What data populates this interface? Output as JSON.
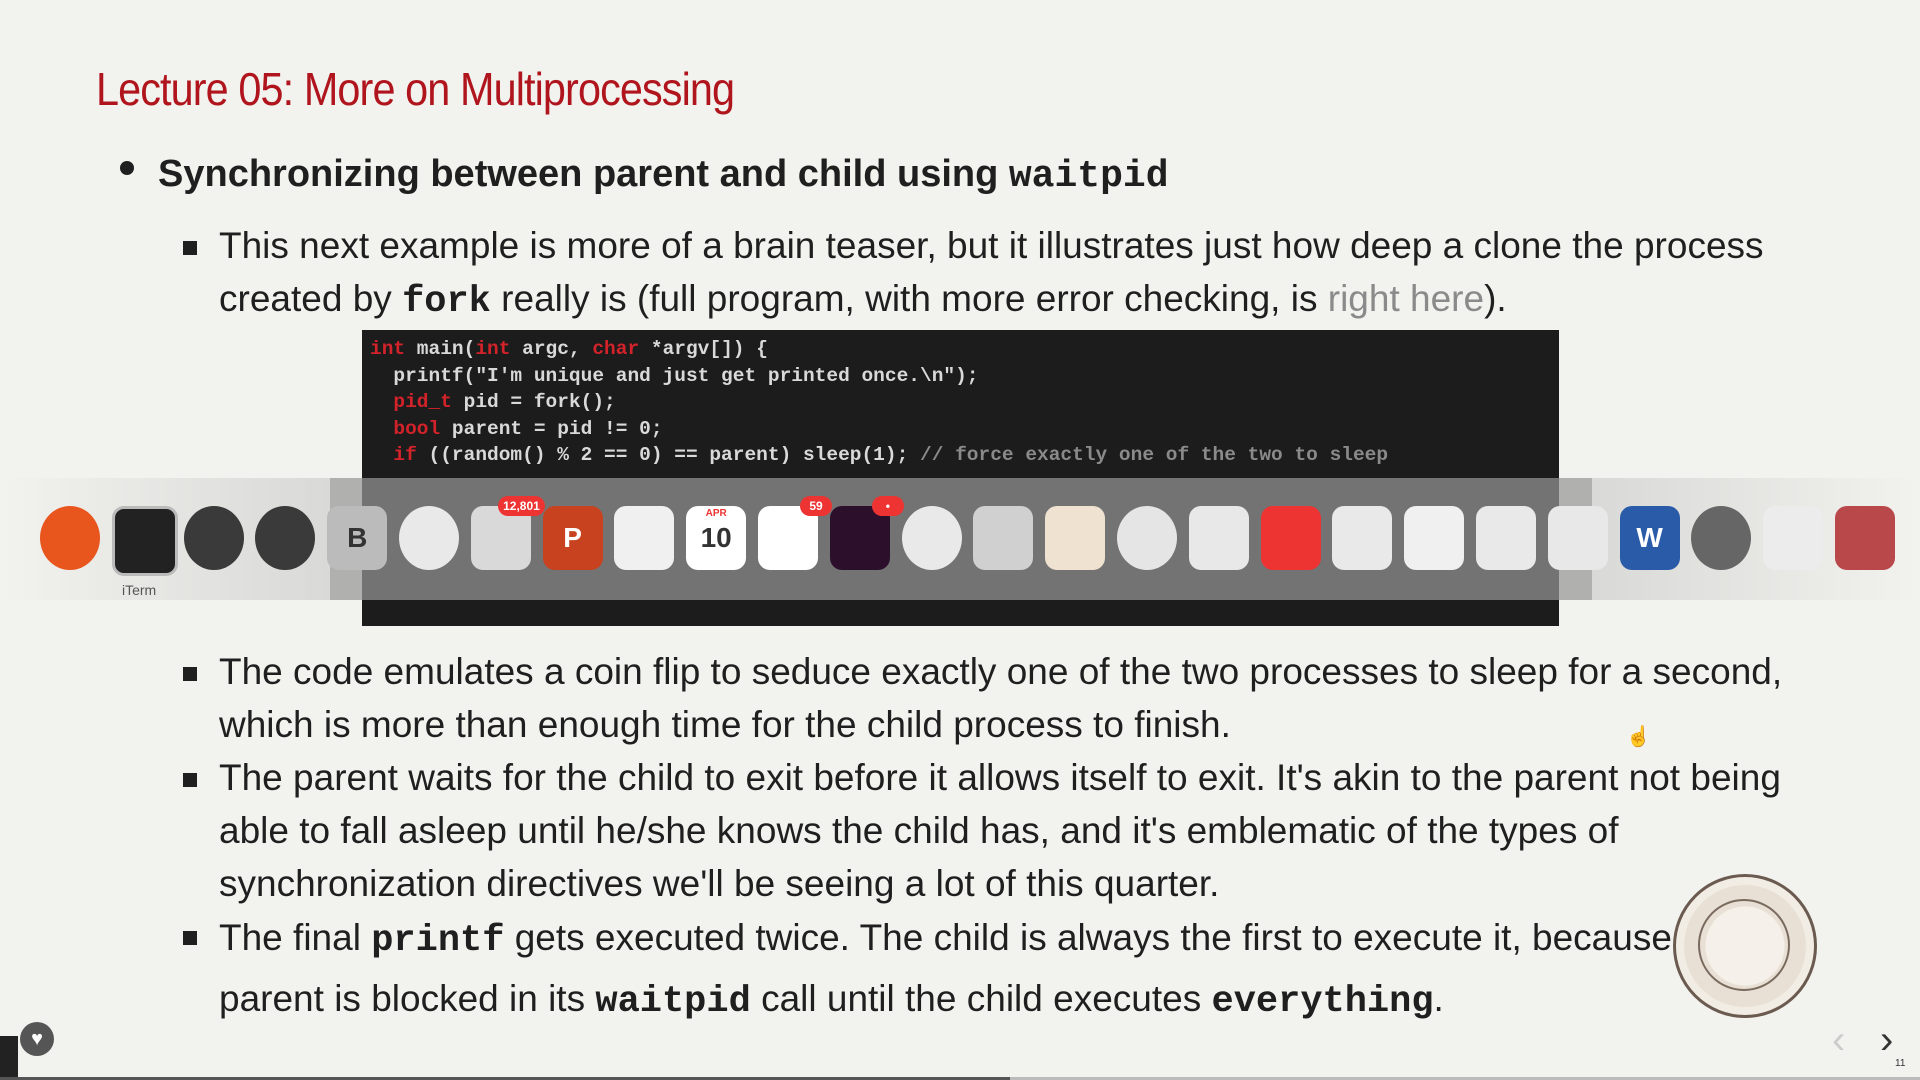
{
  "slide": {
    "title": "Lecture 05: More on Multiprocessing",
    "bullet1": {
      "text": "Synchronizing between parent and child using ",
      "code": "waitpid"
    },
    "sub1": {
      "text_a": "This next example is more of a brain teaser, but it illustrates just how deep a clone the process created by ",
      "code": "fork",
      "text_b": " really is (full program, with more error checking, is ",
      "link": "right here",
      "text_c": ")."
    },
    "sub2": "The code emulates a coin flip to seduce exactly one of the two processes to sleep for a second, which is more than enough time for the child process to finish.",
    "sub3": "The parent waits for the child to exit before it allows itself to exit. It's akin to the parent not being able to fall asleep until he/she knows the child has, and it's emblematic of the types of synchronization directives we'll be seeing a lot of this quarter.",
    "sub4": {
      "text_a": "The final ",
      "code_a": "printf",
      "text_b": " gets executed twice. The child is always the first to execute it, because the parent is blocked in its ",
      "code_b": "waitpid",
      "text_c": " call until the child executes ",
      "code_c": "everything",
      "text_d": "."
    },
    "code_lines": [
      {
        "kw1": "int",
        "a": " main(",
        "kw2": "int",
        "b": " argc, ",
        "kw3": "char",
        "c": " *argv[]) {"
      },
      {
        "a": "  printf(\"I'm unique and just get printed once.\\n\");"
      },
      {
        "kw1": "  pid_t",
        "a": " pid = fork();"
      },
      {
        "kw1": "  bool",
        "a": " parent = pid != 0;"
      },
      {
        "kw1": "  if",
        "a": " ((random() % 2 == 0) == parent) sleep(1); ",
        "cm": "// force exactly one of the two to sleep"
      }
    ],
    "page_number": "11"
  },
  "dock": {
    "items": [
      {
        "name": "firefox-icon",
        "label": ""
      },
      {
        "name": "iterm-icon",
        "label": "iTerm"
      },
      {
        "name": "quill-icon",
        "label": ""
      },
      {
        "name": "quicktime-icon",
        "label": ""
      },
      {
        "name": "bbedit-icon",
        "label": "B"
      },
      {
        "name": "safari-icon",
        "label": ""
      },
      {
        "name": "mail-icon",
        "label": "",
        "badge": "12,801"
      },
      {
        "name": "powerpoint-icon",
        "label": "P"
      },
      {
        "name": "messages-icon",
        "label": ""
      },
      {
        "name": "calendar-icon",
        "label": "10",
        "month": "APR"
      },
      {
        "name": "reminders-icon",
        "label": "",
        "badge": "59"
      },
      {
        "name": "slack-icon",
        "label": "",
        "badge": "•"
      },
      {
        "name": "chrome-icon",
        "label": ""
      },
      {
        "name": "preview-icon",
        "label": ""
      },
      {
        "name": "textedit-icon",
        "label": ""
      },
      {
        "name": "teamviewer-icon",
        "label": ""
      },
      {
        "name": "finder-icon",
        "label": ""
      },
      {
        "name": "airmail-icon",
        "label": ""
      },
      {
        "name": "photo-booth-icon",
        "label": ""
      },
      {
        "name": "keynote-icon",
        "label": ""
      },
      {
        "name": "photos-icon",
        "label": ""
      },
      {
        "name": "screen-draw-icon",
        "label": ""
      },
      {
        "name": "word-icon",
        "label": "W"
      },
      {
        "name": "system-preferences-icon",
        "label": ""
      },
      {
        "name": "folder-icon",
        "label": ""
      },
      {
        "name": "trash-icon",
        "label": ""
      }
    ]
  },
  "colors": {
    "title": "#b0151e",
    "keyword": "#d2222a",
    "link": "#8a8a8a",
    "code_bg": "#1c1c1c"
  }
}
